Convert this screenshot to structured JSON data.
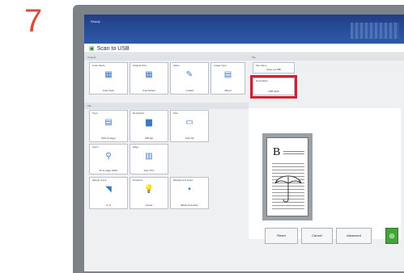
{
  "step_number": "7",
  "status": {
    "text": "Ready"
  },
  "window": {
    "title": "Scan to USB"
  },
  "sections": {
    "original": "Original",
    "file": "File",
    "destination_section": "File"
  },
  "cards": {
    "color_mode": {
      "label": "Color Mode",
      "value": "Auto Color"
    },
    "original_size": {
      "label": "Original Size",
      "value": "Auto Detect"
    },
    "sides": {
      "label": "Sides",
      "value": "1-sided"
    },
    "image_type": {
      "label": "Image Type",
      "value": "Mixed"
    },
    "file_name": {
      "label": "File Name",
      "value": "Scan to USB"
    },
    "destination": {
      "label": "Destination",
      "value": "USB Stick"
    },
    "type": {
      "label": "Type",
      "value": "PDF (Image)"
    },
    "resolution": {
      "label": "Resolution",
      "value": "300 dpi"
    },
    "size": {
      "label": "Size",
      "value": "Auto A4"
    },
    "zoom": {
      "label": "Zoom",
      "value": "Fit to page 100%"
    },
    "edge": {
      "label": "Edge",
      "value": "Auto Trim"
    },
    "margin": {
      "label": "Margin erase",
      "value": "0 / 0"
    },
    "position": {
      "label": "Positions",
      "value": "Center"
    },
    "background": {
      "label": "Background erase",
      "value": "Black and white"
    }
  },
  "buttons": {
    "reset": "Reset",
    "cancel": "Cancel",
    "advanced": "Advanced"
  },
  "icons": {
    "start": "start-icon",
    "preview_umbrella": "umbrella-icon"
  }
}
